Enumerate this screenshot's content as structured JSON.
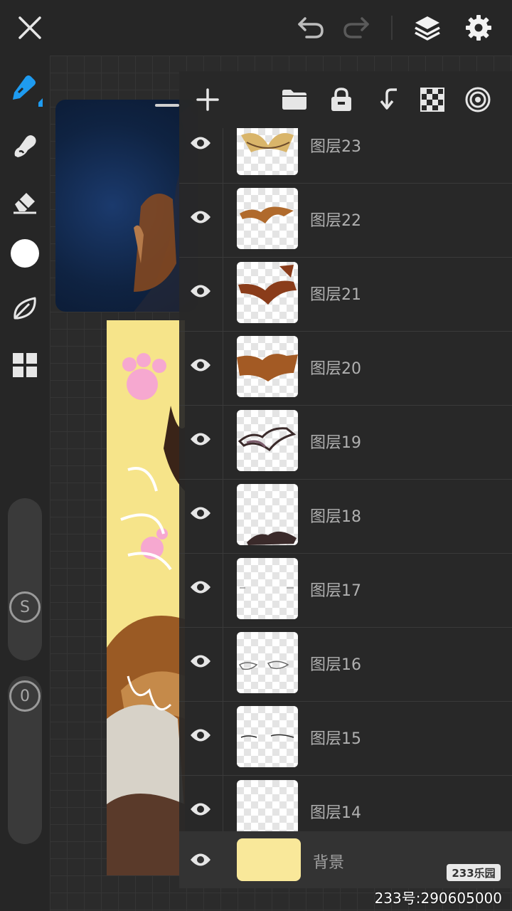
{
  "colors": {
    "accent": "#1e9bf0",
    "background": "#262626",
    "panel": "#282828",
    "background_layer_color": "#f9e89a"
  },
  "topbar": {
    "icons": [
      "close-icon",
      "undo-icon",
      "redo-icon",
      "layers-icon",
      "settings-icon"
    ]
  },
  "toolbar": {
    "tools": [
      "brush-icon",
      "smudge-icon",
      "eraser-icon",
      "color-swatch",
      "leaf-icon",
      "grid-icon"
    ],
    "size_label": "S",
    "opacity_label": "0"
  },
  "layers_panel": {
    "toolbar_icons": [
      "add-layer-icon",
      "folder-icon",
      "lock-icon",
      "merge-down-icon",
      "transparency-icon",
      "target-icon"
    ],
    "layers": [
      {
        "name": "图层23"
      },
      {
        "name": "图层22"
      },
      {
        "name": "图层21"
      },
      {
        "name": "图层20"
      },
      {
        "name": "图层19"
      },
      {
        "name": "图层18"
      },
      {
        "name": "图层17"
      },
      {
        "name": "图层16"
      },
      {
        "name": "图层15"
      },
      {
        "name": "图层14"
      }
    ],
    "background_layer": {
      "name": "背景"
    }
  },
  "watermark": {
    "logo": "233乐园",
    "text": "233号:290605000"
  }
}
